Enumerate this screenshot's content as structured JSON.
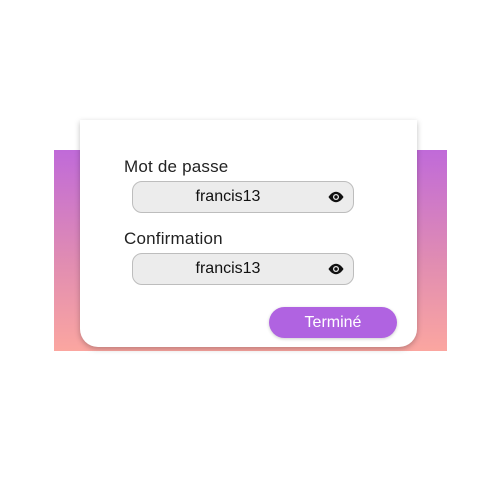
{
  "form": {
    "password_label": "Mot de passe",
    "password_value": "francis13",
    "confirm_label": "Confirmation",
    "confirm_value": "francis13",
    "done_label": "Terminé"
  },
  "icons": {
    "visibility_toggle": "eye-icon"
  },
  "colors": {
    "accent": "#b063e1",
    "gradient_top": "#c06ad9",
    "gradient_bottom": "#fba6a0",
    "field_bg": "#ececec"
  }
}
